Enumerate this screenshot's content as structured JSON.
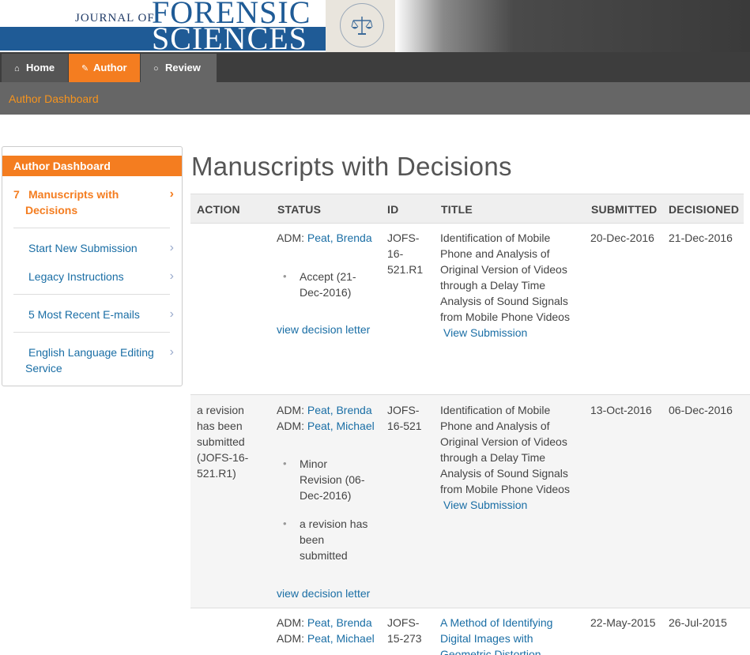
{
  "header": {
    "journal_prefix": "JOURNAL OF",
    "journal_word1": "FORENSIC",
    "journal_word2": "SCIENCES"
  },
  "nav": {
    "home": "Home",
    "author": "Author",
    "review": "Review"
  },
  "subnav": {
    "label": "Author Dashboard"
  },
  "sidebar": {
    "title": "Author Dashboard",
    "active_count": "7",
    "active_line1": "Manuscripts with",
    "active_line2": "Decisions",
    "start_new": "Start New Submission",
    "legacy": "Legacy Instructions",
    "recent_emails": "5 Most Recent E-mails",
    "english_line1": "English Language Editing",
    "english_line2": "Service"
  },
  "main": {
    "title": "Manuscripts with Decisions",
    "columns": [
      "ACTION",
      "STATUS",
      "ID",
      "TITLE",
      "SUBMITTED",
      "DECISIONED"
    ]
  },
  "rows": [
    {
      "action": [],
      "status_lines": [
        {
          "prefix": "ADM:",
          "name": "Peat, Brenda"
        }
      ],
      "bullets": [
        [
          "Accept (21-",
          "Dec-2016)"
        ]
      ],
      "decision_link": "view decision letter",
      "id_lines": [
        "JOFS-",
        "16-",
        "521.R1"
      ],
      "title_lines": [
        "Identification of Mobile",
        "Phone and Analysis of",
        "Original Version of Videos",
        "through a Delay Time",
        "Analysis of Sound Signals",
        "from Mobile Phone Videos"
      ],
      "view_link": "View Submission",
      "submitted": "20-Dec-2016",
      "decisioned": "21-Dec-2016"
    },
    {
      "action": [
        "a revision",
        "has been",
        "submitted",
        "(JOFS-16-",
        "521.R1)"
      ],
      "status_lines": [
        {
          "prefix": "ADM:",
          "name": "Peat, Brenda"
        },
        {
          "prefix": "ADM:",
          "name": "Peat, Michael"
        }
      ],
      "bullets": [
        [
          "Minor",
          "Revision (06-",
          "Dec-2016)"
        ],
        [
          "a revision has",
          "been",
          "submitted"
        ]
      ],
      "decision_link": "view decision letter",
      "id_lines": [
        "JOFS-",
        "16-521"
      ],
      "title_lines": [
        "Identification of Mobile",
        "Phone and Analysis of",
        "Original Version of Videos",
        "through a Delay Time",
        "Analysis of Sound Signals",
        "from Mobile Phone Videos"
      ],
      "view_link": "View Submission",
      "submitted": "13-Oct-2016",
      "decisioned": "06-Dec-2016"
    },
    {
      "action": [],
      "status_lines": [
        {
          "prefix": "ADM:",
          "name": "Peat, Brenda"
        },
        {
          "prefix": "ADM:",
          "name": "Peat, Michael"
        }
      ],
      "id_lines": [
        "JOFS-",
        "15-273"
      ],
      "title_lines": [
        "A Method of Identifying",
        "Digital Images with",
        "Geometric Distortion"
      ],
      "submitted": "22-May-2015",
      "decisioned": "26-Jul-2015"
    }
  ]
}
